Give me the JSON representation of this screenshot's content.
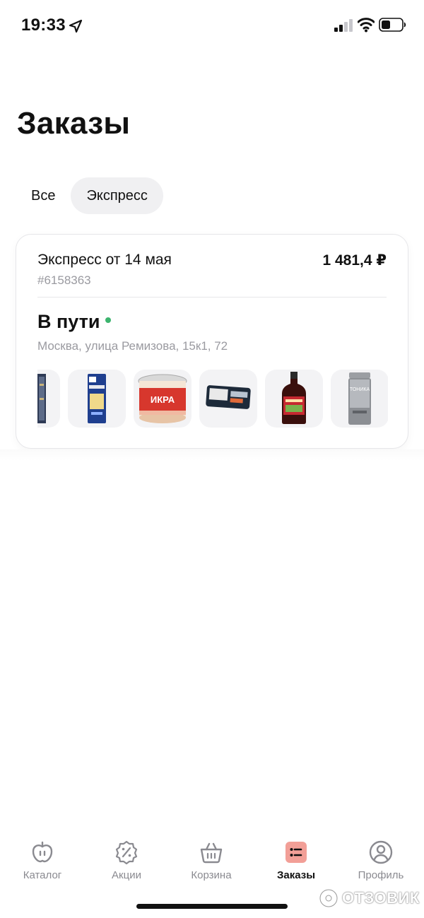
{
  "status_bar": {
    "time": "19:33"
  },
  "page": {
    "title": "Заказы"
  },
  "tabs": [
    {
      "label": "Все",
      "active": false
    },
    {
      "label": "Экспресс",
      "active": true
    }
  ],
  "order": {
    "name": "Экспресс от 14 мая",
    "price": "1 481,4 ₽",
    "number": "#6158363",
    "status": "В пути",
    "address": "Москва, улица Ремизова, 15к1, 72",
    "status_color": "#3cb46e",
    "items": [
      {
        "icon": "pasta-pack-icon"
      },
      {
        "icon": "spaghetti-pack-icon"
      },
      {
        "icon": "caviar-jar-icon",
        "label": "ИКРА"
      },
      {
        "icon": "frozen-pack-icon"
      },
      {
        "icon": "oil-bottle-icon"
      },
      {
        "icon": "hair-tonic-bottle-icon",
        "label": "ТОНИКА"
      }
    ]
  },
  "nav": [
    {
      "label": "Каталог",
      "icon": "apple-icon",
      "active": false
    },
    {
      "label": "Акции",
      "icon": "percent-badge-icon",
      "active": false
    },
    {
      "label": "Корзина",
      "icon": "basket-icon",
      "active": false
    },
    {
      "label": "Заказы",
      "icon": "orders-list-icon",
      "active": true
    },
    {
      "label": "Профиль",
      "icon": "profile-icon",
      "active": false
    }
  ],
  "watermark": {
    "text": "ОТЗОВИК"
  },
  "colors": {
    "accent": "#f29f97",
    "muted": "#9a9aa0",
    "tab_active_bg": "#f0f0f2"
  }
}
